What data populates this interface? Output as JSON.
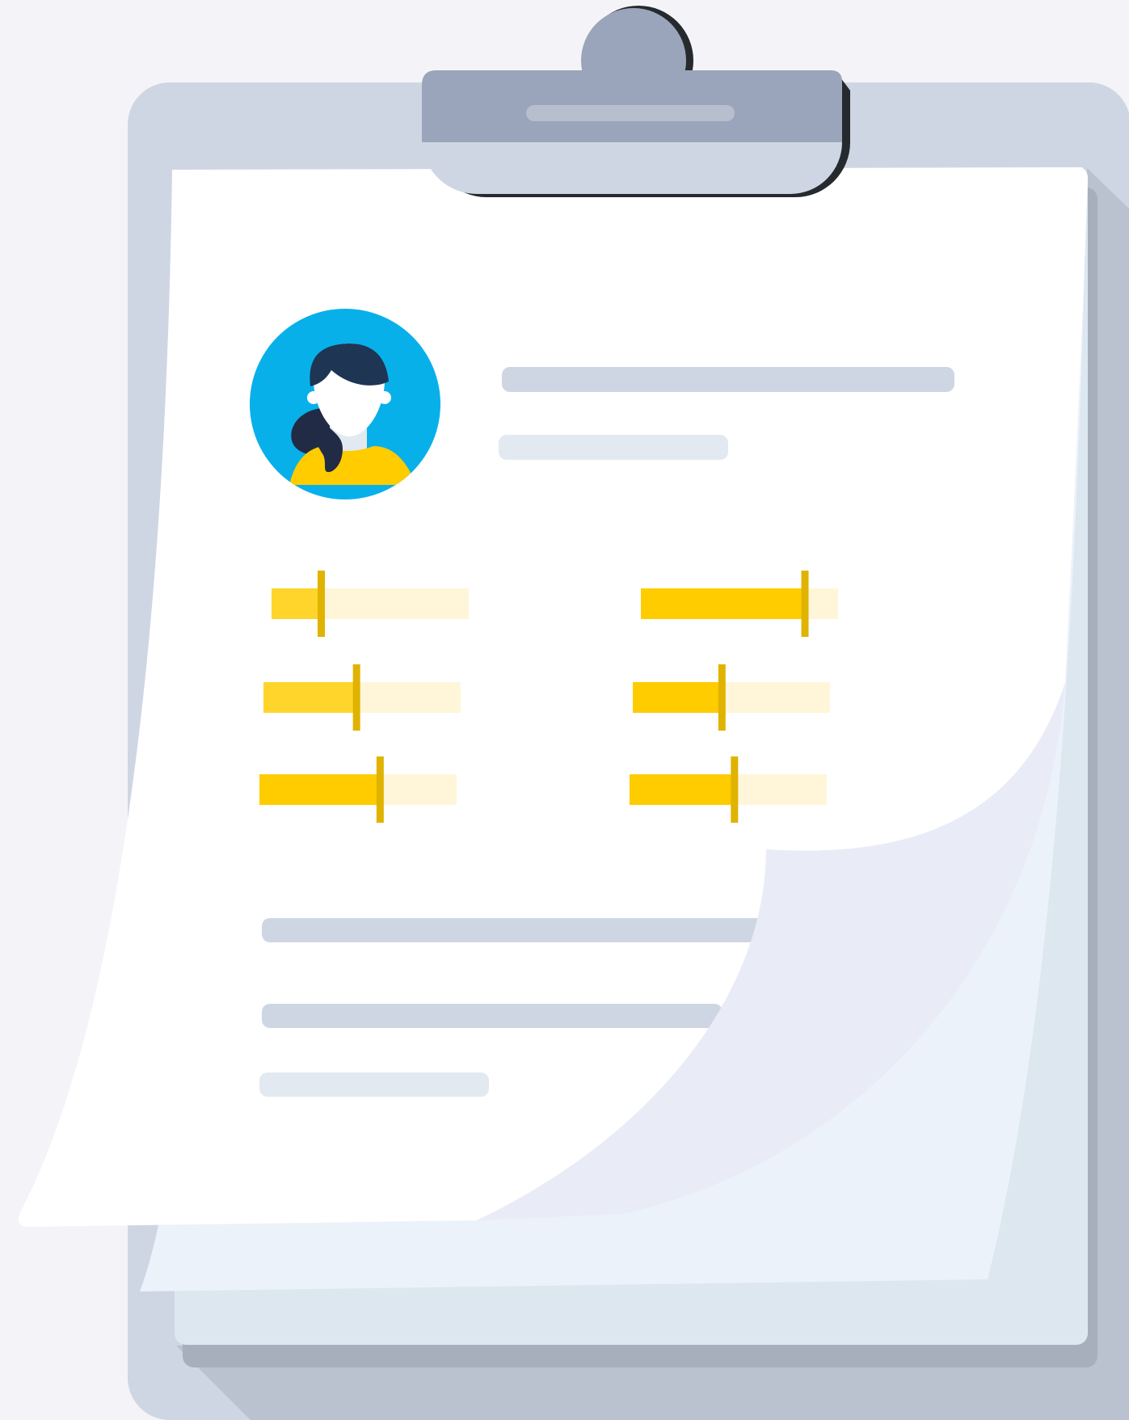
{
  "illustration": {
    "subject": "clipboard-profile",
    "icons": [
      "clipboard-icon",
      "user-avatar-icon",
      "skill-slider-icon"
    ],
    "colors": {
      "background": "#f4f4f8",
      "board": "#cfd6e3",
      "board_shadow": "#bac2cf",
      "clip": "#9aa5bb",
      "clip_dark": "#252a2f",
      "paper": "#ffffff",
      "paper_back": "#dde7f0",
      "paper_mid": "#ecf2f9",
      "curl": "#e9ecf7",
      "avatar_bg": "#08b0ea",
      "hair": "#1e3553",
      "shirt": "#ffcc00",
      "slider_fill": "#ffcc00",
      "slider_track": "#fff6d9",
      "slider_handle": "#e0b300",
      "text_line": "#cfd6e3",
      "text_line_light": "#e2e9f1"
    },
    "skill_levels": [
      {
        "name": "skill-1",
        "level": 0.25
      },
      {
        "name": "skill-2",
        "level": 0.47
      },
      {
        "name": "skill-3",
        "level": 0.61
      },
      {
        "name": "skill-4",
        "level": 0.83
      },
      {
        "name": "skill-5",
        "level": 0.45
      },
      {
        "name": "skill-6",
        "level": 0.53
      }
    ]
  }
}
